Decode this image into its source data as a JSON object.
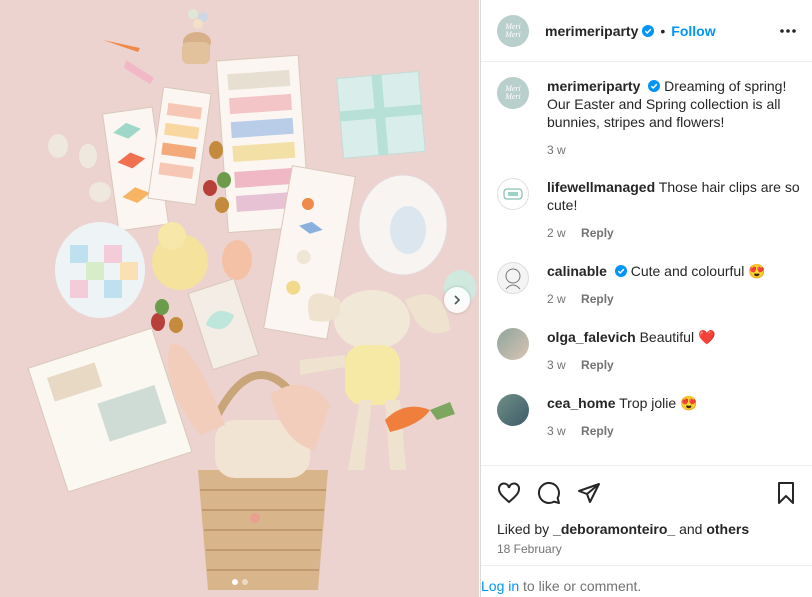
{
  "post": {
    "username": "merimeriparty",
    "follow_label": "Follow",
    "bullet": "•",
    "logo_text": "Meri Meri",
    "caption": "Dreaming of spring! Our Easter and Spring collection is all bunnies, stripes and flowers!",
    "caption_time": "3 w"
  },
  "comments": [
    {
      "user": "lifewellmanaged",
      "text": "Those hair clips are so cute!",
      "time": "2 w",
      "reply": "Reply",
      "verified": false,
      "emoji": ""
    },
    {
      "user": "calinable",
      "text": "Cute and colourful",
      "time": "2 w",
      "reply": "Reply",
      "verified": true,
      "emoji": "😍"
    },
    {
      "user": "olga_falevich",
      "text": "Beautiful",
      "time": "3 w",
      "reply": "Reply",
      "verified": false,
      "emoji": "❤️"
    },
    {
      "user": "cea_home",
      "text": "Trop jolie",
      "time": "3 w",
      "reply": "Reply",
      "verified": false,
      "emoji": "😍"
    }
  ],
  "footer": {
    "liked_prefix": "Liked by",
    "liked_user": "_deboramonteiro_",
    "liked_and": "and",
    "liked_others": "others",
    "date": "18 February",
    "login_link": "Log in",
    "login_text": "to like or comment."
  },
  "colors": {
    "accent": "#0095f6",
    "background_photo": "#ecd3cf",
    "heart": "#ed4956"
  },
  "icons": [
    "like-heart-icon",
    "comment-icon",
    "share-icon",
    "save-bookmark-icon",
    "more-options-icon",
    "verified-badge-icon",
    "chevron-right-icon"
  ]
}
